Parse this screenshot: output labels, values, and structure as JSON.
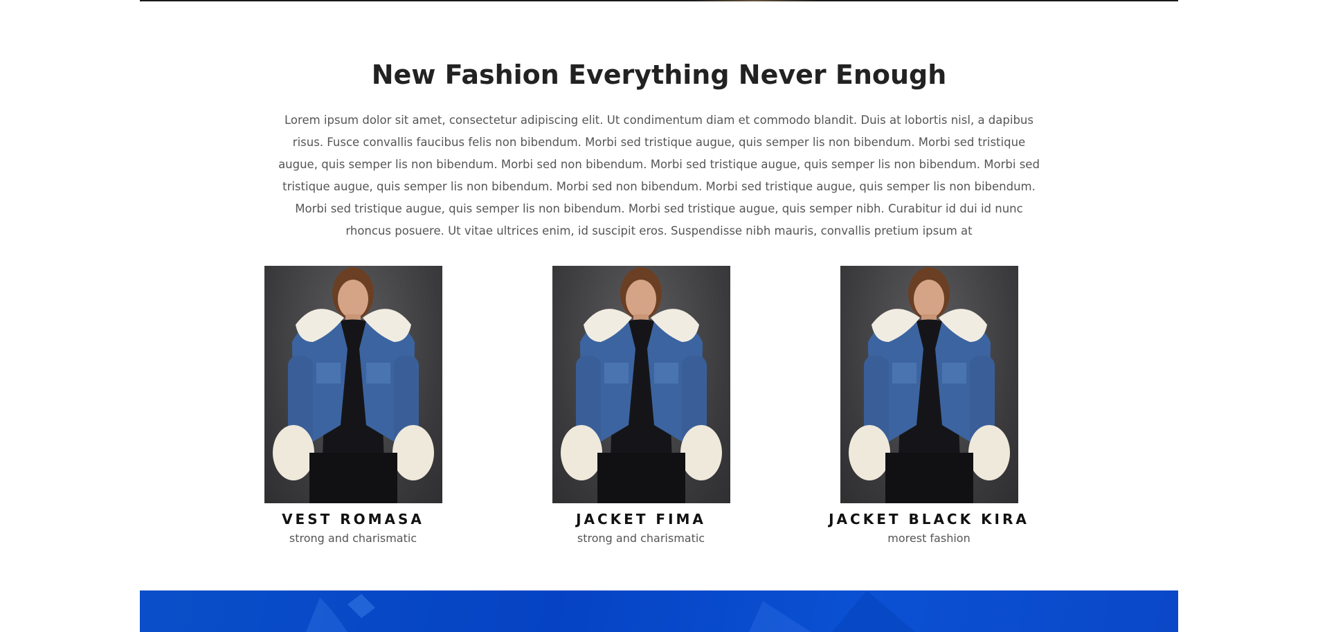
{
  "section": {
    "title": "New Fashion Everything Never Enough",
    "body": "Lorem ipsum dolor sit amet, consectetur adipiscing elit. Ut condimentum diam et commodo blandit. Duis at lobortis nisl, a dapibus risus. Fusce convallis faucibus felis non bibendum. Morbi sed tristique augue, quis semper lis non bibendum. Morbi sed tristique augue, quis semper lis non bibendum. Morbi sed non bibendum. Morbi sed tristique augue, quis semper lis non bibendum. Morbi sed tristique augue, quis semper lis non bibendum. Morbi sed non bibendum. Morbi sed tristique augue, quis semper lis non bibendum. Morbi sed tristique augue, quis semper lis non bibendum. Morbi sed tristique augue, quis semper nibh. Curabitur id dui id nunc rhoncus posuere. Ut vitae ultrices enim, id suscipit eros. Suspendisse nibh mauris, convallis pretium ipsum at"
  },
  "products": [
    {
      "name": "VEST ROMASA",
      "tagline": "strong and charismatic"
    },
    {
      "name": "JACKET FIMA",
      "tagline": "strong and charismatic"
    },
    {
      "name": "JACKET BLACK KIRA",
      "tagline": "morest fashion"
    }
  ],
  "colors": {
    "heading": "#222222",
    "body_text": "#555555",
    "product_name": "#111111",
    "banner_blue": "#0543c4",
    "denim": "#3c64a0",
    "fur": "#f0ece2"
  },
  "icons": {
    "product_photo": "model-in-denim-jacket-with-fur-trim"
  }
}
